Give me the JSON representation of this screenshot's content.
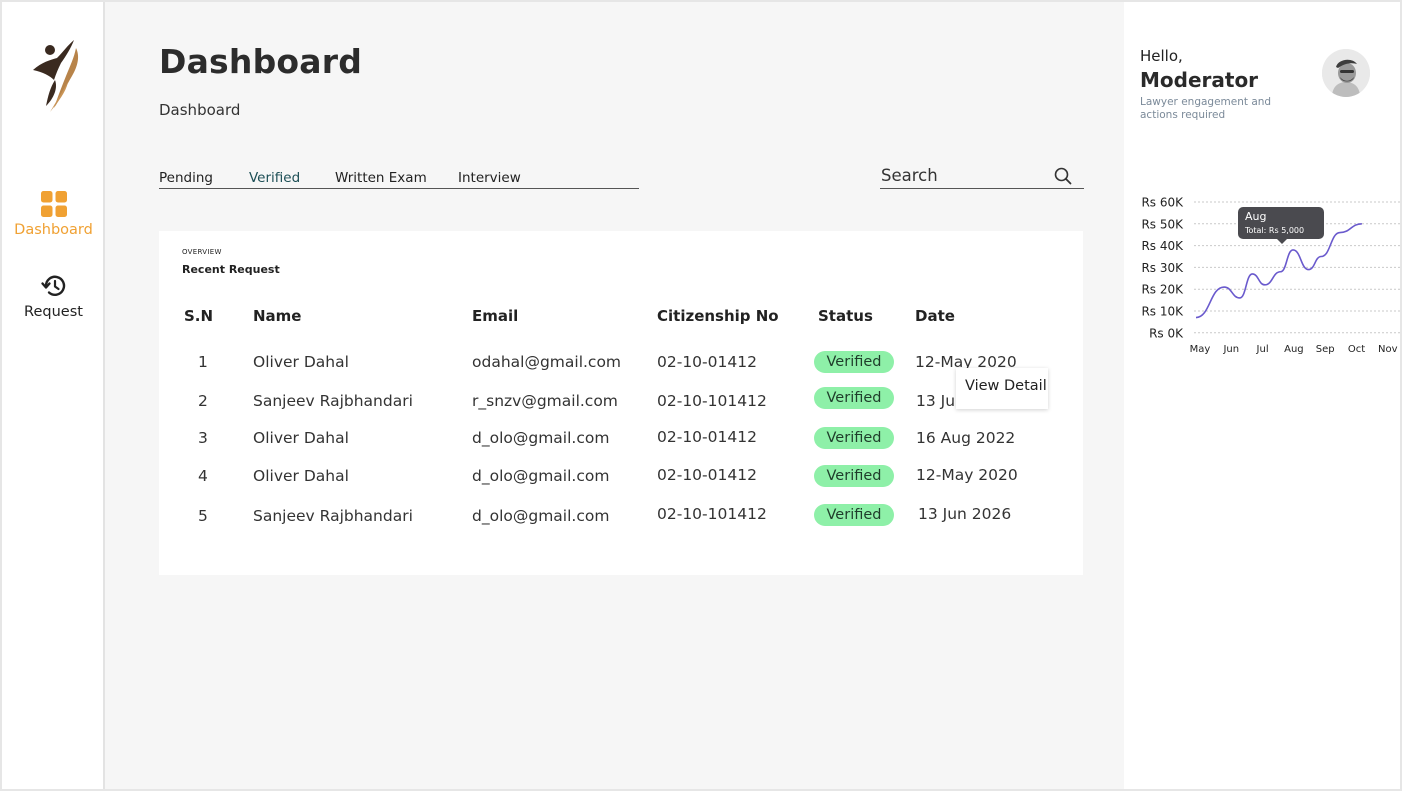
{
  "sidebar": {
    "items": [
      {
        "label": "Dashboard",
        "icon": "grid-icon",
        "active": true
      },
      {
        "label": "Request",
        "icon": "history-icon",
        "active": false
      }
    ]
  },
  "header": {
    "title": "Dashboard",
    "breadcrumb": "Dashboard"
  },
  "tabs": [
    "Pending",
    "Verified",
    "Written Exam",
    "Interview"
  ],
  "active_tab": "Verified",
  "search": {
    "placeholder": "Search",
    "value": ""
  },
  "card": {
    "overline": "OVERVIEW",
    "title": "Recent Request",
    "columns": [
      "S.N",
      "Name",
      "Email",
      "Citizenship No",
      "Status",
      "Date"
    ],
    "rows": [
      {
        "sn": "1",
        "name": "Oliver Dahal",
        "email": "odahal@gmail.com",
        "citizenship": "02-10-01412",
        "status": "Verified",
        "date": "12-May 2020"
      },
      {
        "sn": "2",
        "name": "Sanjeev Rajbhandari",
        "email": "r_snzv@gmail.com",
        "citizenship": "02-10-101412",
        "status": "Verified",
        "date": "13 Ju"
      },
      {
        "sn": "3",
        "name": "Oliver Dahal",
        "email": "d_olo@gmail.com",
        "citizenship": "02-10-01412",
        "status": "Verified",
        "date": "16 Aug 2022"
      },
      {
        "sn": "4",
        "name": "Oliver Dahal",
        "email": "d_olo@gmail.com",
        "citizenship": "02-10-01412",
        "status": "Verified",
        "date": "12-May 2020"
      },
      {
        "sn": "5",
        "name": "Sanjeev Rajbhandari",
        "email": "d_olo@gmail.com",
        "citizenship": "02-10-101412",
        "status": "Verified",
        "date": "13 Jun 2026"
      }
    ],
    "popover_label": "View Detail"
  },
  "profile": {
    "greeting": "Hello,",
    "role": "Moderator",
    "subtitle": "Lawyer engagement and actions required"
  },
  "colors": {
    "accent": "#f0a133",
    "active_tab": "#1d4f56",
    "badge_bg": "#8ef0a8",
    "chart_line": "#6a5acd",
    "tooltip_bg": "#4a4a4f"
  },
  "chart_data": {
    "type": "line",
    "x": [
      "May",
      "Jun",
      "Jul",
      "Aug",
      "Sep",
      "Oct",
      "Nov"
    ],
    "series": [
      {
        "values": [
          7000,
          21000,
          16000,
          27000,
          22000,
          28000,
          38000,
          29000,
          35000,
          46000,
          50000
        ]
      }
    ],
    "x_positions": [
      0,
      0.9,
      1.4,
      1.8,
      2.2,
      2.7,
      3.1,
      3.6,
      4.0,
      4.6,
      5.3
    ],
    "yticks": [
      "Rs 60K",
      "Rs 50K",
      "Rs 40K",
      "Rs 30K",
      "Rs 20K",
      "Rs 10K",
      "Rs 0K"
    ],
    "ylim": [
      0,
      60000
    ],
    "grid": true,
    "tooltip": {
      "title": "Aug",
      "text": "Total: Rs 5,000"
    }
  }
}
